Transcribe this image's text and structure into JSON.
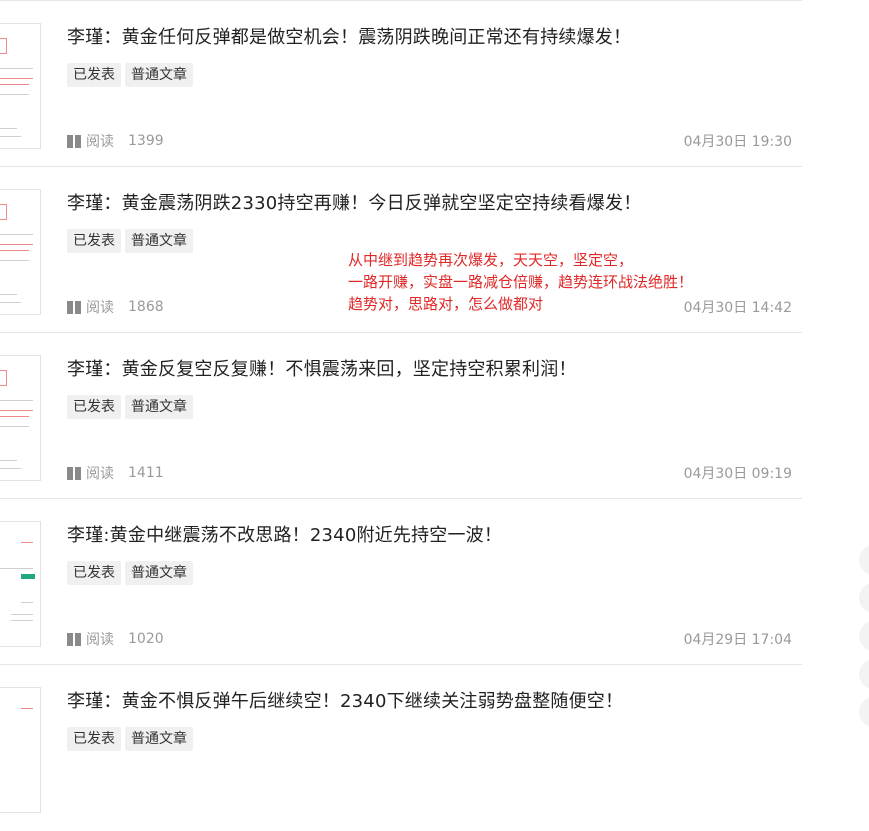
{
  "articles": [
    {
      "title": "李瑾：黄金任何反弹都是做空机会！震荡阴跌晚间正常还有持续爆发！",
      "tags": [
        "已发表",
        "普通文章"
      ],
      "read_label": "阅读",
      "reads": "1399",
      "date": "04月30日 19:30"
    },
    {
      "title": "李瑾：黄金震荡阴跌2330持空再赚！今日反弹就空坚定空持续看爆发！",
      "tags": [
        "已发表",
        "普通文章"
      ],
      "read_label": "阅读",
      "reads": "1868",
      "date": "04月30日 14:42"
    },
    {
      "title": "李瑾：黄金反复空反复赚！不惧震荡来回，坚定持空积累利润！",
      "tags": [
        "已发表",
        "普通文章"
      ],
      "read_label": "阅读",
      "reads": "1411",
      "date": "04月30日 09:19"
    },
    {
      "title": "李瑾:黄金中继震荡不改思路！2340附近先持空一波！",
      "tags": [
        "已发表",
        "普通文章"
      ],
      "read_label": "阅读",
      "reads": "1020",
      "date": "04月29日 17:04"
    },
    {
      "title": "李瑾：黄金不惧反弹午后继续空！2340下继续关注弱势盘整随便空！",
      "tags": [
        "已发表",
        "普通文章"
      ],
      "read_label": "",
      "reads": "",
      "date": ""
    }
  ],
  "overlay_text": [
    "从中继到趋势再次爆发，天天空，坚定空，",
    "一路开赚，实盘一路减仓倍赚，趋势连环战法绝胜！",
    "趋势对，思路对，怎么做都对"
  ],
  "colors": {
    "overlay": "#e02828",
    "meta": "#9a9a9a",
    "tag_bg": "#f0f0f0"
  }
}
